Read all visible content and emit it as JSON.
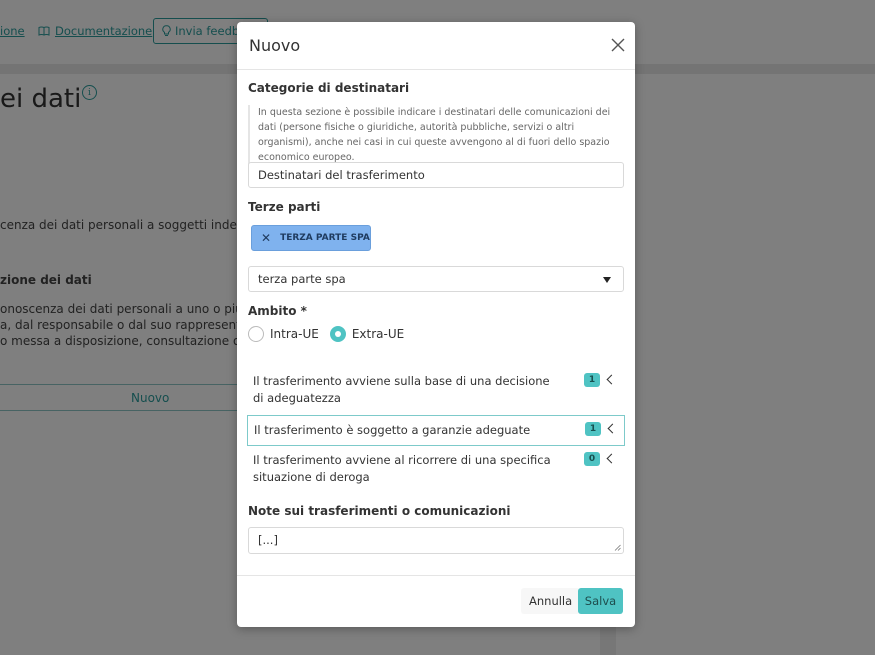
{
  "background": {
    "links": {
      "link1": "ione",
      "documentation": "Documentazione",
      "feedback": "Invia feedback"
    },
    "page_title": "ei dati",
    "text_line1": "cenza dei dati personali a soggetti indetermina",
    "subheading": "zione dei dati",
    "text_line2": "onoscenza dei dati personali a uno o più sogg",
    "text_line3": "a, dal responsabile o dal suo rappresentante n",
    "text_line4": "o messa a disposizione, consultazione o medi",
    "new_button": "Nuovo"
  },
  "modal": {
    "title": "Nuovo",
    "recipients_category_label": "Categorie di destinatari",
    "recipients_help": "In questa sezione è possibile indicare i destinatari delle comunicazioni dei dati (persone fisiche o giuridiche, autorità pubbliche, servizi o altri organismi), anche nei casi in cui queste avvengono al di fuori dello spazio economico europeo.",
    "recipients_value": "Destinatari del trasferimento",
    "third_parties_label": "Terze parti",
    "selected_tag": "TERZA PARTE SPA",
    "third_party_select_value": "terza parte spa",
    "scope_label": "Ambito *",
    "scope_options": [
      {
        "label": "Intra-UE",
        "checked": false
      },
      {
        "label": "Extra-UE",
        "checked": true
      }
    ],
    "transfer_items": [
      {
        "label": "Il trasferimento avviene sulla base di una decisione di adeguatezza",
        "count": "1"
      },
      {
        "label": "Il trasferimento è soggetto a garanzie adeguate",
        "count": "1"
      },
      {
        "label": "Il trasferimento avviene al ricorrere di una specifica situazione di deroga",
        "count": "0"
      }
    ],
    "notes_label": "Note sui trasferimenti o comunicazioni",
    "notes_value": "[...]",
    "cancel_label": "Annulla",
    "save_label": "Salva"
  },
  "colors": {
    "accent": "#4fc3c3",
    "link": "#2a9d9d",
    "tag_bg": "#7fb2ee"
  }
}
